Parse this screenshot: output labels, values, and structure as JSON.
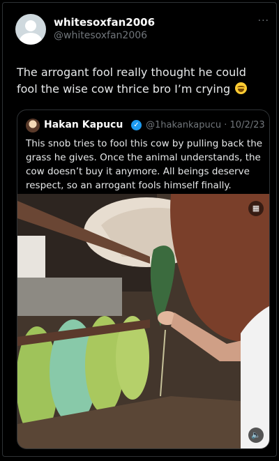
{
  "post": {
    "author": {
      "display_name": "whitesoxfan2006",
      "handle": "@whitesoxfan2006",
      "avatar_icon": "default-avatar-icon"
    },
    "more_label": "···",
    "text": "The arrogant fool really thought he could fool the wise cow thrice bro I’m crying",
    "text_emoji": "laughing-crying-emoji"
  },
  "quote": {
    "author": {
      "display_name": "Hakan Kapucu",
      "verified_icon": "verified-badge-icon",
      "handle_and_date": "@1hakankapucu · 10/2/23"
    },
    "text": "This snob tries to fool this cow by pulling back the grass he gives. Once the animal understands, the cow doesn’t buy it anymore. All beings deserve respect, so an arrogant fools himself finally.",
    "media": {
      "kind": "video",
      "gif_badge_icon": "gif-icon",
      "volume_icon": "speaker-icon"
    }
  },
  "colors": {
    "background": "#000000",
    "border": "#2f3336",
    "text_primary": "#e7e9ea",
    "text_secondary": "#71767b",
    "verified": "#1d9bf0"
  }
}
